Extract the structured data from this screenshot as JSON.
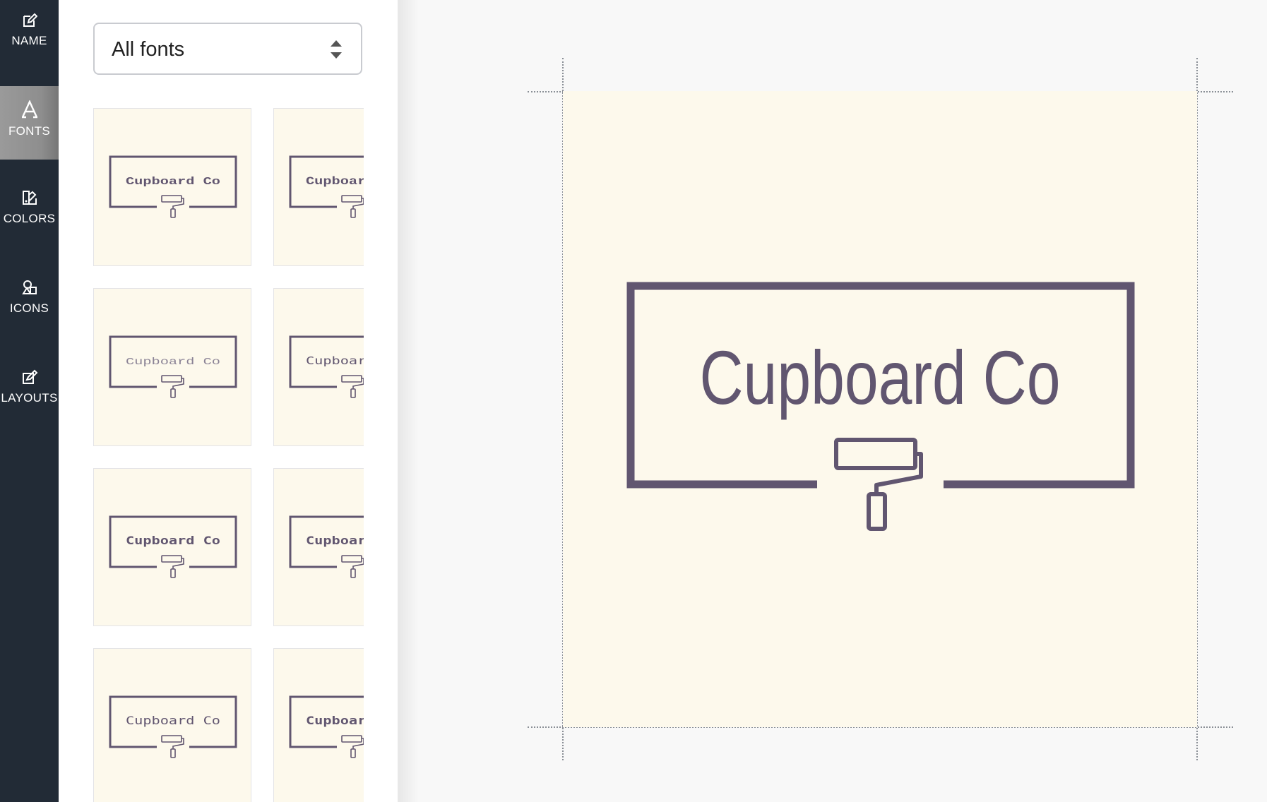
{
  "sidebar": {
    "items": [
      {
        "label": "NAME",
        "icon": "edit-icon",
        "active": false
      },
      {
        "label": "FONTS",
        "icon": "font-icon",
        "active": true
      },
      {
        "label": "COLORS",
        "icon": "palette-icon",
        "active": false
      },
      {
        "label": "ICONS",
        "icon": "shapes-icon",
        "active": false
      },
      {
        "label": "LAYOUTS",
        "icon": "layouts-icon",
        "active": false
      }
    ]
  },
  "panel": {
    "font_filter": {
      "selected": "All fonts"
    },
    "thumbnails": [
      {
        "text": "Cupboard Co"
      },
      {
        "text": "Cupboard Co"
      },
      {
        "text": "Cupboard Co"
      },
      {
        "text": "Cupboard Co"
      },
      {
        "text": "Cupboard Co"
      },
      {
        "text": "Cupboard Co"
      },
      {
        "text": "Cupboard Co"
      },
      {
        "text": "Cupboard Co"
      }
    ]
  },
  "canvas": {
    "logo_text": "Cupboard Co",
    "icon": "paint-roller-icon",
    "colors": {
      "background": "#fdf9ec",
      "primary": "#615670"
    }
  }
}
